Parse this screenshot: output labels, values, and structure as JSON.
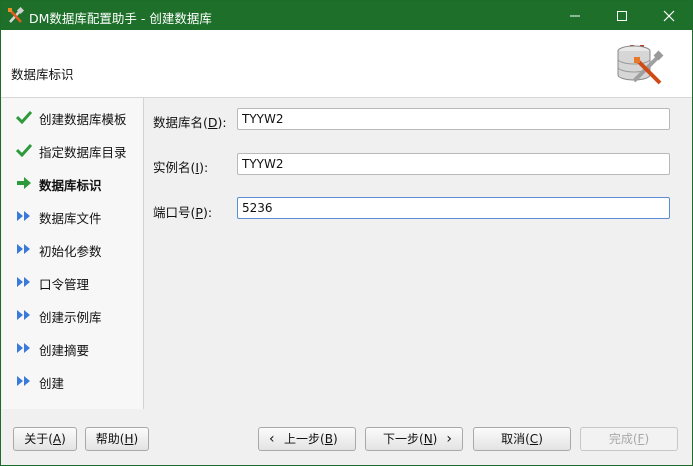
{
  "window": {
    "title": "DM数据库配置助手 - 创建数据库",
    "controls": {
      "minimize": "minimize",
      "maximize": "maximize",
      "close": "close"
    }
  },
  "header": {
    "title": "数据库标识",
    "logo_icon": "database-tools-icon"
  },
  "sidebar": {
    "items": [
      {
        "label": "创建数据库模板",
        "state": "done",
        "icon": "checkmark-icon"
      },
      {
        "label": "指定数据库目录",
        "state": "done",
        "icon": "checkmark-icon"
      },
      {
        "label": "数据库标识",
        "state": "current",
        "icon": "arrow-right-icon"
      },
      {
        "label": "数据库文件",
        "state": "pending",
        "icon": "double-chevron-icon"
      },
      {
        "label": "初始化参数",
        "state": "pending",
        "icon": "double-chevron-icon"
      },
      {
        "label": "口令管理",
        "state": "pending",
        "icon": "double-chevron-icon"
      },
      {
        "label": "创建示例库",
        "state": "pending",
        "icon": "double-chevron-icon"
      },
      {
        "label": "创建摘要",
        "state": "pending",
        "icon": "double-chevron-icon"
      },
      {
        "label": "创建",
        "state": "pending",
        "icon": "double-chevron-icon"
      }
    ]
  },
  "form": {
    "db_name": {
      "label_pre": "数据库名(",
      "mnemonic": "D",
      "label_post": "):",
      "value": "TYYW2"
    },
    "instance_name": {
      "label_pre": "实例名(",
      "mnemonic": "I",
      "label_post": "):",
      "value": "TYYW2"
    },
    "port": {
      "label_pre": "端口号(",
      "mnemonic": "P",
      "label_post": "):",
      "value": "5236"
    }
  },
  "buttons": {
    "about": {
      "pre": "关于(",
      "mnemonic": "A",
      "post": ")"
    },
    "help": {
      "pre": "帮助(",
      "mnemonic": "H",
      "post": ")"
    },
    "back": {
      "glyph": "‹",
      "pre": "上一步(",
      "mnemonic": "B",
      "post": ")"
    },
    "next": {
      "glyph": "›",
      "pre": "下一步(",
      "mnemonic": "N",
      "post": ")"
    },
    "cancel": {
      "pre": "取消(",
      "mnemonic": "C",
      "post": ")"
    },
    "finish": {
      "pre": "完成(",
      "mnemonic": "F",
      "post": ")",
      "disabled": true
    }
  },
  "colors": {
    "titlebar": "#1d6f2a",
    "check": "#2e9a3c",
    "chevron": "#3b7ad8",
    "focus": "#5b8ed6"
  }
}
